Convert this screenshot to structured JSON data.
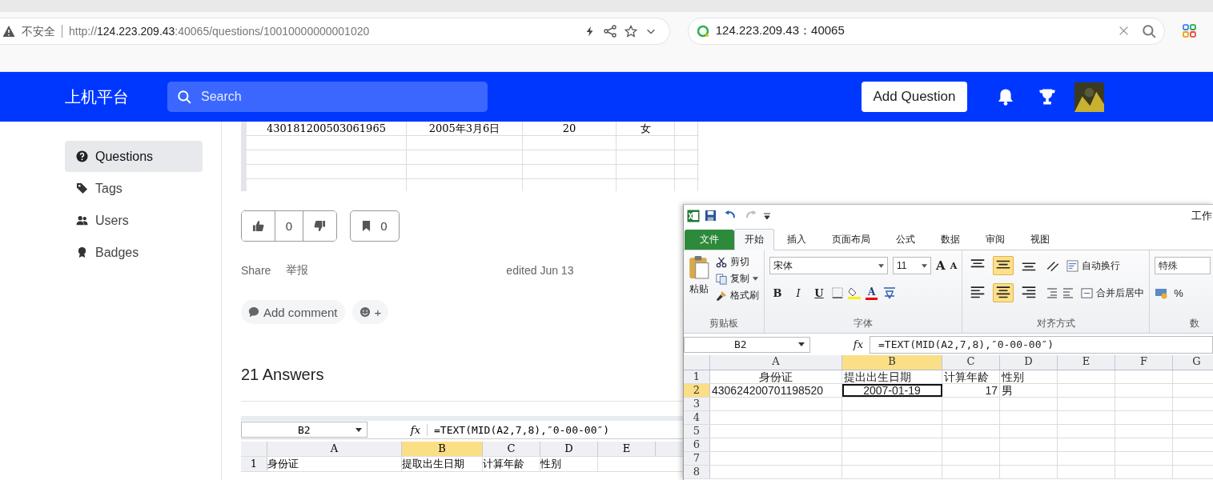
{
  "browser": {
    "security_label": "不安全",
    "url": {
      "scheme": "http://",
      "host": "124.223.209.43",
      "rest": ":40065/questions/10010000000001020"
    },
    "search_query": "124.223.209.43：40065"
  },
  "header": {
    "logo": "上机平台",
    "search": {
      "placeholder": "Search"
    },
    "add_button": "Add Question"
  },
  "sidebar": {
    "items": [
      {
        "label": "Questions",
        "selected": true
      },
      {
        "label": "Tags",
        "selected": false
      },
      {
        "label": "Users",
        "selected": false
      },
      {
        "label": "Badges",
        "selected": false
      }
    ]
  },
  "question": {
    "sheet_rows": [
      [
        "430181200503061965",
        "2005年3月6日",
        "20",
        "女"
      ]
    ],
    "votes": {
      "score": "0",
      "bookmarks": "0"
    },
    "actions": [
      "Share",
      "举报"
    ],
    "edited": "edited Jun 13",
    "add_comment": "Add comment",
    "react": "+"
  },
  "answers": {
    "title": "21 Answers",
    "sheet": {
      "name_box": "B2",
      "function_label": "fx",
      "formula": "=TEXT(MID(A2,7,8),″0-00-00″)",
      "columns": [
        {
          "label": "A",
          "selected": false
        },
        {
          "label": "B",
          "selected": true
        },
        {
          "label": "C",
          "selected": false
        },
        {
          "label": "D",
          "selected": false
        },
        {
          "label": "E",
          "selected": false
        }
      ],
      "rows": [
        {
          "number": "1",
          "cells": [
            "身份证",
            "提取出生日期",
            "计算年龄",
            "性别"
          ]
        }
      ]
    }
  },
  "excel": {
    "title": "工作",
    "tabs": [
      {
        "label": "文件",
        "kind": "file",
        "selected": false
      },
      {
        "label": "开始",
        "kind": "tab",
        "selected": true
      },
      {
        "label": "插入",
        "kind": "tab",
        "selected": false
      },
      {
        "label": "页面布局",
        "kind": "tab",
        "selected": false
      },
      {
        "label": "公式",
        "kind": "tab",
        "selected": false
      },
      {
        "label": "数据",
        "kind": "tab",
        "selected": false
      },
      {
        "label": "审阅",
        "kind": "tab",
        "selected": false
      },
      {
        "label": "视图",
        "kind": "tab",
        "selected": false
      }
    ],
    "clipboard": {
      "paste": "粘贴",
      "cut": "剪切",
      "copy": "复制",
      "format_painter": "格式刷",
      "group": "剪贴板"
    },
    "font": {
      "name": "宋体",
      "size": "11",
      "bold": "B",
      "italic": "I",
      "underline": "U",
      "grow": "A",
      "shrink": "A",
      "color_letter": "A",
      "group": "字体"
    },
    "alignment": {
      "vertical": [
        {
          "selected": false
        },
        {
          "selected": true
        },
        {
          "selected": false
        }
      ],
      "horizontal": [
        {
          "selected": false
        },
        {
          "selected": true
        },
        {
          "selected": false
        }
      ],
      "wrap": "自动换行",
      "merge": "合并后居中",
      "group": "对齐方式"
    },
    "number": {
      "format": "特殊",
      "percent": "%",
      "group": "数"
    },
    "name_box": "B2",
    "formula": "=TEXT(MID(A2,7,8),″0-00-00″)",
    "columns": [
      {
        "label": "A",
        "selected": false
      },
      {
        "label": "B",
        "selected": true
      },
      {
        "label": "C",
        "selected": false
      },
      {
        "label": "D",
        "selected": false
      },
      {
        "label": "E",
        "selected": false
      },
      {
        "label": "F",
        "selected": false
      },
      {
        "label": "G",
        "selected": false
      }
    ],
    "function_label": "fx",
    "rows": [
      {
        "number": "1",
        "selected": false,
        "cells": [
          {
            "text": "身份证",
            "centered": true,
            "right_aligned": false
          },
          {
            "text": "提出出生日期",
            "centered": false,
            "right_aligned": false
          },
          {
            "text": "计算年龄",
            "centered": false,
            "right_aligned": false
          },
          {
            "text": "性别",
            "centered": false,
            "right_aligned": false
          }
        ]
      },
      {
        "number": "2",
        "selected": true,
        "cells": [
          {
            "text": "430624200701198520",
            "centered": false,
            "right_aligned": false
          },
          {
            "text": "2007-01-19",
            "centered": true,
            "right_aligned": false
          },
          {
            "text": "17",
            "centered": false,
            "right_aligned": true
          },
          {
            "text": "男",
            "centered": false,
            "right_aligned": false
          }
        ]
      },
      {
        "number": "3",
        "selected": false
      },
      {
        "number": "4",
        "selected": false
      },
      {
        "number": "5",
        "selected": false
      },
      {
        "number": "6",
        "selected": false
      },
      {
        "number": "7",
        "selected": false
      },
      {
        "number": "8",
        "selected": false
      }
    ]
  }
}
